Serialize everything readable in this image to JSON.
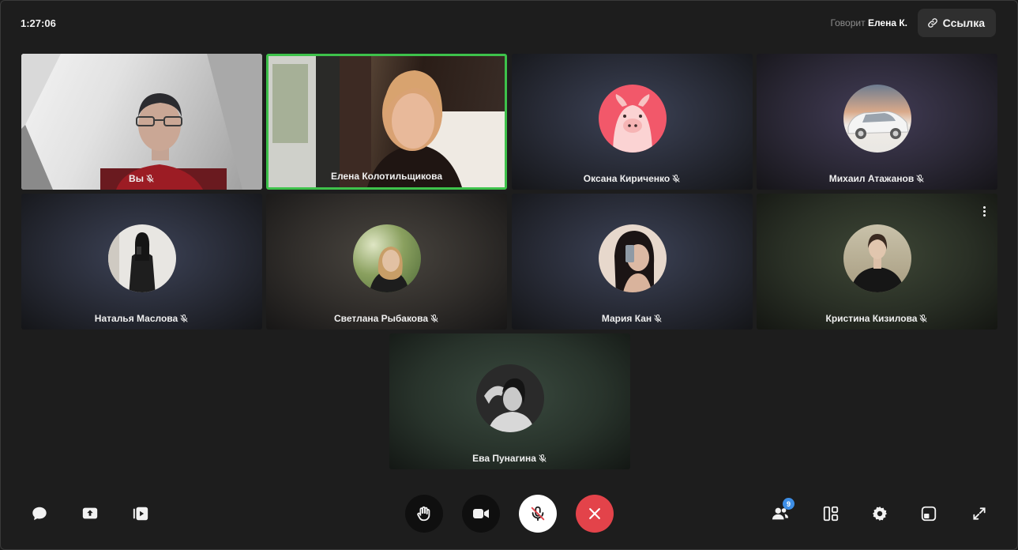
{
  "header": {
    "timer": "1:27:06",
    "speaking_label": "Говорит",
    "speaking_name": "Елена К.",
    "link_label": "Ссылка"
  },
  "participants": [
    {
      "name": "Вы",
      "muted": true,
      "video": true
    },
    {
      "name": "Елена Колотильщикова",
      "muted": false,
      "video": true,
      "speaking": true
    },
    {
      "name": "Оксана Кириченко",
      "muted": true,
      "video": false
    },
    {
      "name": "Михаил Атажанов",
      "muted": true,
      "video": false
    },
    {
      "name": "Наталья Маслова",
      "muted": true,
      "video": false
    },
    {
      "name": "Светлана Рыбакова",
      "muted": true,
      "video": false
    },
    {
      "name": "Мария Кан",
      "muted": true,
      "video": false
    },
    {
      "name": "Кристина Кизилова",
      "muted": true,
      "video": false
    },
    {
      "name": "Ева Пунагина",
      "muted": true,
      "video": false
    }
  ],
  "toolbar": {
    "left": [
      "chat-icon",
      "screen-share-icon",
      "media-icon"
    ],
    "center": [
      "raise-hand-icon",
      "camera-icon",
      "microphone-muted-icon",
      "hang-up-icon"
    ],
    "right": [
      "participants-icon",
      "layout-icon",
      "settings-icon",
      "pip-icon",
      "fullscreen-icon"
    ],
    "participants_count": "9"
  },
  "colors": {
    "speaking_border": "#3ec24b",
    "hangup": "#e3434a",
    "badge": "#3d8ee6"
  }
}
